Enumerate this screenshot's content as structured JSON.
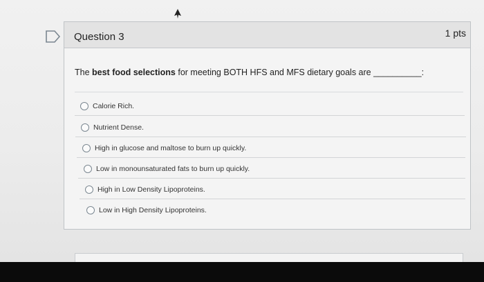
{
  "question": {
    "title": "Question 3",
    "points": "1 pts",
    "prompt_before": "The ",
    "prompt_bold": "best food selections",
    "prompt_after": " for meeting BOTH HFS and MFS dietary goals are __________:"
  },
  "answers": [
    "Calorie Rich.",
    "Nutrient Dense.",
    "High in glucose and maltose to burn up quickly.",
    "Low in monounsaturated fats to burn up quickly.",
    "High in Low Density Lipoproteins.",
    "Low in High Density Lipoproteins."
  ],
  "icons": {
    "flag": "bookmark-flag-icon",
    "cursor": "mouse-cursor-icon",
    "radio": "radio-button"
  },
  "colors": {
    "header_bg": "#e3e3e3",
    "card_border": "#bfc3c6",
    "text": "#222222"
  }
}
